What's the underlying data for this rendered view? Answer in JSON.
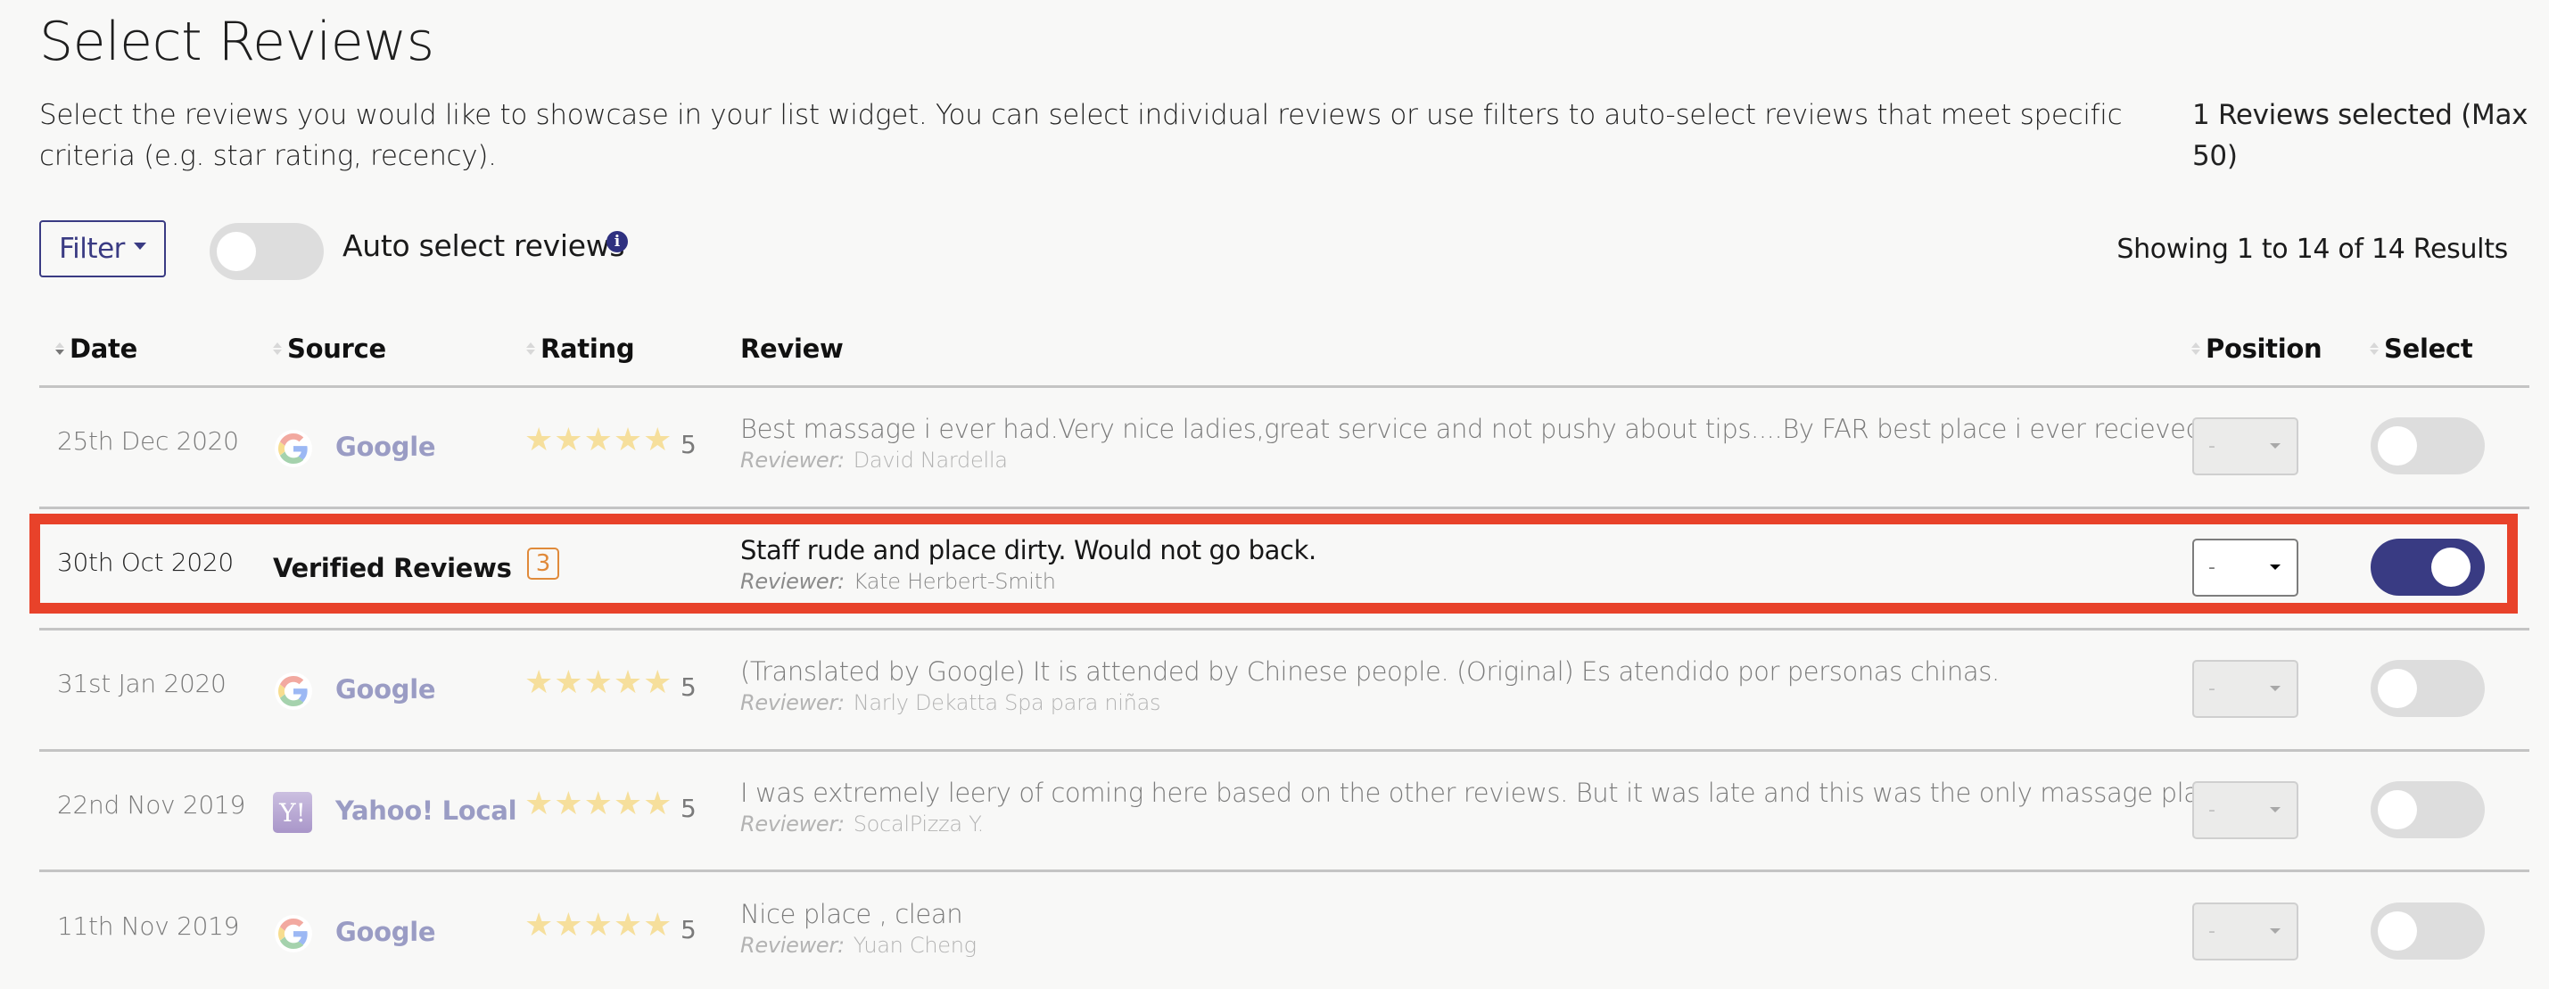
{
  "page": {
    "title": "Select Reviews",
    "description": "Select the reviews you would like to showcase in your list widget. You can select individual reviews or use filters to auto-select reviews that meet specific criteria (e.g. star rating, recency).",
    "selected_count": "1 Reviews selected (Max 50)"
  },
  "toolbar": {
    "filter_label": "Filter",
    "auto_select_label": "Auto select reviews",
    "auto_select_on": false,
    "info_icon": "i",
    "showing": "Showing 1 to 14 of 14 Results"
  },
  "table": {
    "headers": {
      "date": "Date",
      "source": "Source",
      "rating": "Rating",
      "review": "Review",
      "position": "Position",
      "select": "Select"
    },
    "reviewer_prefix": "Reviewer:",
    "rows": [
      {
        "date": "25th Dec 2020",
        "source": "Google",
        "source_icon": "google-logo-icon",
        "rating": "5",
        "stars": 5,
        "text": "Best massage i ever had.Very nice ladies,great service and not pushy about tips....By FAR best place i ever recieved a",
        "truncated": true,
        "reviewer": "David Nardella",
        "position": "-",
        "selected": false
      },
      {
        "date": "30th Oct 2020",
        "source": "Verified Reviews",
        "source_icon": "",
        "rating": "3",
        "stars": 0,
        "text": "Staff rude and place dirty. Would not go back.",
        "truncated": false,
        "reviewer": "Kate Herbert-Smith",
        "position": "-",
        "selected": true
      },
      {
        "date": "31st Jan 2020",
        "source": "Google",
        "source_icon": "google-logo-icon",
        "rating": "5",
        "stars": 5,
        "text": "(Translated by Google) It is attended by Chinese people. (Original) Es atendido por personas chinas.",
        "truncated": false,
        "reviewer": "Narly Dekatta Spa para niñas",
        "position": "-",
        "selected": false
      },
      {
        "date": "22nd Nov 2019",
        "source": "Yahoo! Local",
        "source_icon": "yahoo-logo-icon",
        "rating": "5",
        "stars": 5,
        "text": "I was extremely leery of coming here based on the other reviews. But it was late and this was the only massage place",
        "truncated": true,
        "reviewer": "SocalPizza Y.",
        "position": "-",
        "selected": false
      },
      {
        "date": "11th Nov 2019",
        "source": "Google",
        "source_icon": "google-logo-icon",
        "rating": "5",
        "stars": 5,
        "text": "Nice place , clean",
        "truncated": false,
        "reviewer": "Yuan Cheng",
        "position": "-",
        "selected": false
      }
    ]
  },
  "colors": {
    "accent": "#393b83",
    "highlight": "#e8422a",
    "star": "#f6df9c",
    "badge": "#e08a3a"
  }
}
